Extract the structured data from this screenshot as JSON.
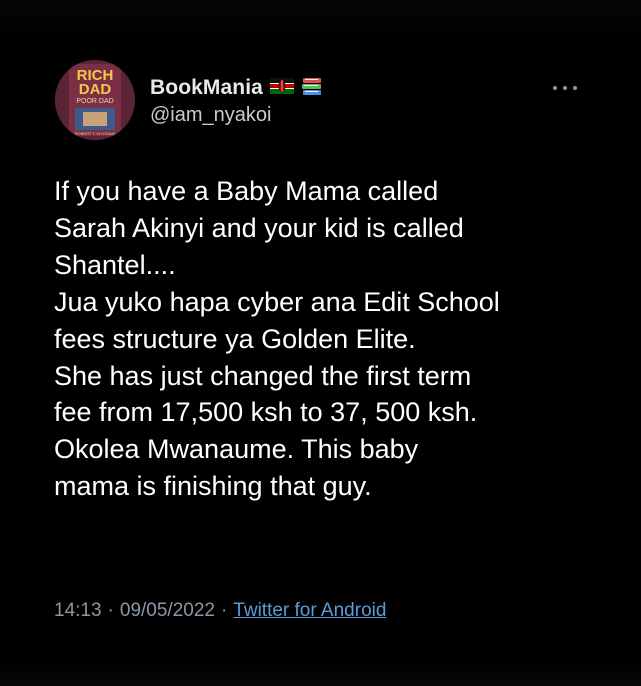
{
  "tweet": {
    "author": {
      "display_name": "BookMania",
      "handle": "@iam_nyakoi",
      "avatar_text": {
        "line1": "RICH",
        "line2": "DAD",
        "line3": "POOR DAD",
        "author": "ROBERT T. KIYOSAKI"
      },
      "badges": [
        "kenya-flag-icon",
        "books-icon"
      ]
    },
    "text_lines": [
      "If you have a Baby Mama called",
      "Sarah Akinyi and your kid is called",
      "Shantel....",
      "Jua yuko hapa cyber ana Edit School",
      "fees structure ya Golden Elite.",
      "She has just changed the first term",
      "fee from 17,500 ksh to 37, 500 ksh.",
      "Okolea Mwanaume. This baby",
      "mama is finishing that guy."
    ],
    "time": "14:13",
    "date": "09/05/2022",
    "separator": "·",
    "source": "Twitter for Android"
  },
  "colors": {
    "background": "#000000",
    "text": "#ffffff",
    "secondary": "#8b98a5",
    "link": "#5b9bd5"
  },
  "icons": {
    "more": "more-horizontal-icon"
  }
}
